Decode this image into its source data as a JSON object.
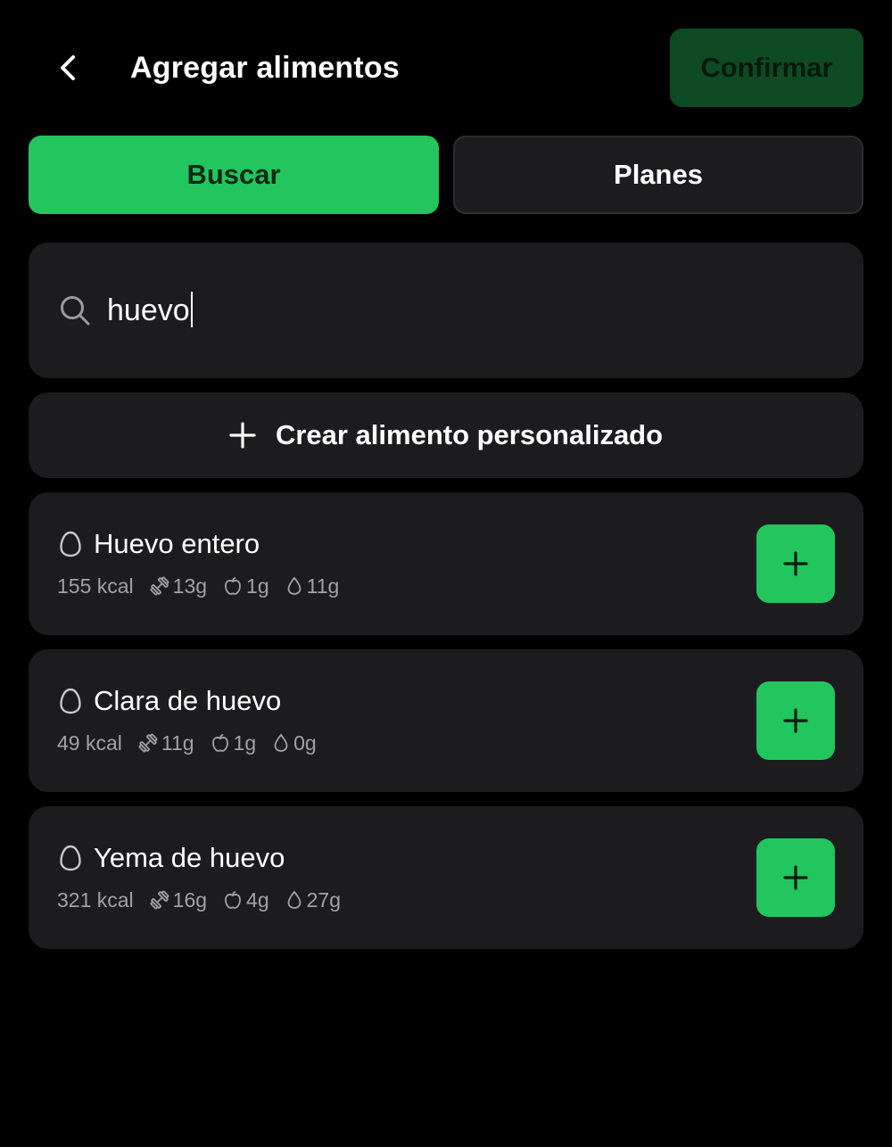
{
  "header": {
    "back_icon": "chevron-left-icon",
    "title": "Agregar alimentos",
    "confirm_label": "Confirmar"
  },
  "tabs": [
    {
      "label": "Buscar",
      "active": true
    },
    {
      "label": "Planes",
      "active": false
    }
  ],
  "search": {
    "icon": "search-icon",
    "value": "huevo"
  },
  "create_custom": {
    "icon": "plus-icon",
    "label": "Crear alimento personalizado"
  },
  "foods": [
    {
      "name": "Huevo entero",
      "kcal": "155 kcal",
      "protein": "13g",
      "carbs": "1g",
      "fat": "11g"
    },
    {
      "name": "Clara de huevo",
      "kcal": "49 kcal",
      "protein": "11g",
      "carbs": "1g",
      "fat": "0g"
    },
    {
      "name": "Yema de huevo",
      "kcal": "321 kcal",
      "protein": "16g",
      "carbs": "4g",
      "fat": "27g"
    }
  ],
  "icons": {
    "food": "egg-icon",
    "protein": "dumbbell-icon",
    "carbs": "apple-icon",
    "fat": "drop-icon",
    "add": "plus-icon"
  },
  "colors": {
    "background": "#000000",
    "card": "#1c1c1e",
    "accent": "#22c55e",
    "confirm_disabled": "#0e4a24",
    "muted_text": "#a1a1a6"
  }
}
